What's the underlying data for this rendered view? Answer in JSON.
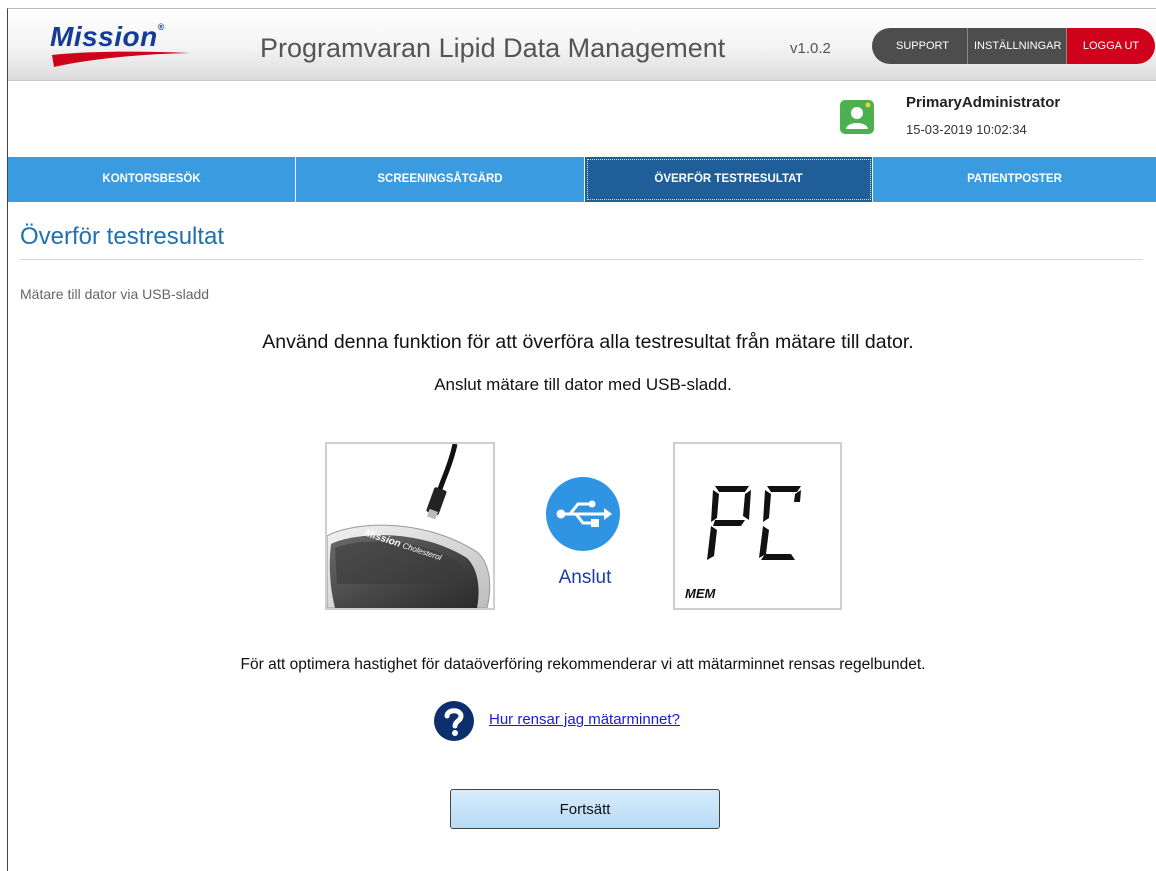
{
  "header": {
    "logo_text": "Mission",
    "logo_mark": "®",
    "app_title": "Programvaran Lipid Data Management",
    "version": "v1.0.2",
    "buttons": {
      "support": "SUPPORT",
      "settings": "INSTÄLLNINGAR",
      "logout": "LOGGA UT"
    }
  },
  "user": {
    "name": "PrimaryAdministrator",
    "datetime": "15-03-2019 10:02:34",
    "avatar_icon": "user-avatar-icon"
  },
  "nav": {
    "tabs": [
      {
        "label": "KONTORSBESÖK"
      },
      {
        "label": "SCREENINGSÅTGÄRD"
      },
      {
        "label": "ÖVERFÖR TESTRESULTAT",
        "active": true
      },
      {
        "label": "PATIENTPOSTER"
      }
    ]
  },
  "main": {
    "title": "Överför testresultat",
    "subheading": "Mätare till dator via USB-sladd",
    "intro_line1": "Använd denna funktion för att överföra alla testresultat från mätare till dator.",
    "intro_line2": "Anslut mätare till dator med USB-sladd.",
    "meter_brand": "Mission",
    "meter_model": "Cholesterol",
    "connect_label": "Anslut",
    "display_text": "PC",
    "display_mem": "MEM",
    "note": "För att optimera hastighet för dataöverföring rekommenderar vi att mätarminnet rensas regelbundet.",
    "help_link": "Hur rensar jag mätarminnet?",
    "continue_button": "Fortsätt"
  },
  "colors": {
    "nav_blue": "#3b9be0",
    "nav_active": "#1f5e98",
    "logout_red": "#d0021b",
    "title_blue": "#1f6fb3",
    "avatar_green": "#4cb050",
    "usb_blue": "#2f95e3"
  }
}
